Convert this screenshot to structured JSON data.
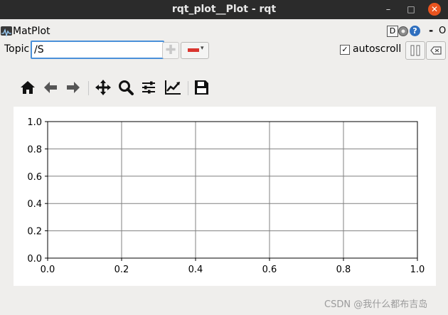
{
  "window": {
    "title": "rqt_plot__Plot - rqt",
    "minimize_glyph": "–",
    "maximize_glyph": "□",
    "close_glyph": "✕"
  },
  "plugin": {
    "title": "MatPlot",
    "d_label": "D",
    "help_label": "?",
    "dash_label": "-",
    "close_label": "O"
  },
  "topic": {
    "label": "Topic",
    "value": "/S",
    "add_glyph": "✚",
    "remove_caret": "▾"
  },
  "autoscroll": {
    "label": "autoscroll",
    "checked": true,
    "check_glyph": "✓"
  },
  "toolbar": {
    "buttons": [
      "home-icon",
      "back-icon",
      "forward-icon",
      "pan-icon",
      "zoom-icon",
      "subplots-icon",
      "customize-icon",
      "save-icon"
    ]
  },
  "colors": {
    "titlebar": "#2b2b2b",
    "close": "#e9541f",
    "focus": "#4a90d9",
    "remove": "#d9352f",
    "grid": "#808080"
  },
  "chart_data": {
    "type": "line",
    "title": "",
    "xlabel": "",
    "ylabel": "",
    "series": [],
    "xlim": [
      0.0,
      1.0
    ],
    "ylim": [
      0.0,
      1.0
    ],
    "xticks": [
      "0.0",
      "0.2",
      "0.4",
      "0.6",
      "0.8",
      "1.0"
    ],
    "yticks": [
      "0.0",
      "0.2",
      "0.4",
      "0.6",
      "0.8",
      "1.0"
    ],
    "grid": true
  },
  "watermark": "CSDN @我什么都布吉岛"
}
